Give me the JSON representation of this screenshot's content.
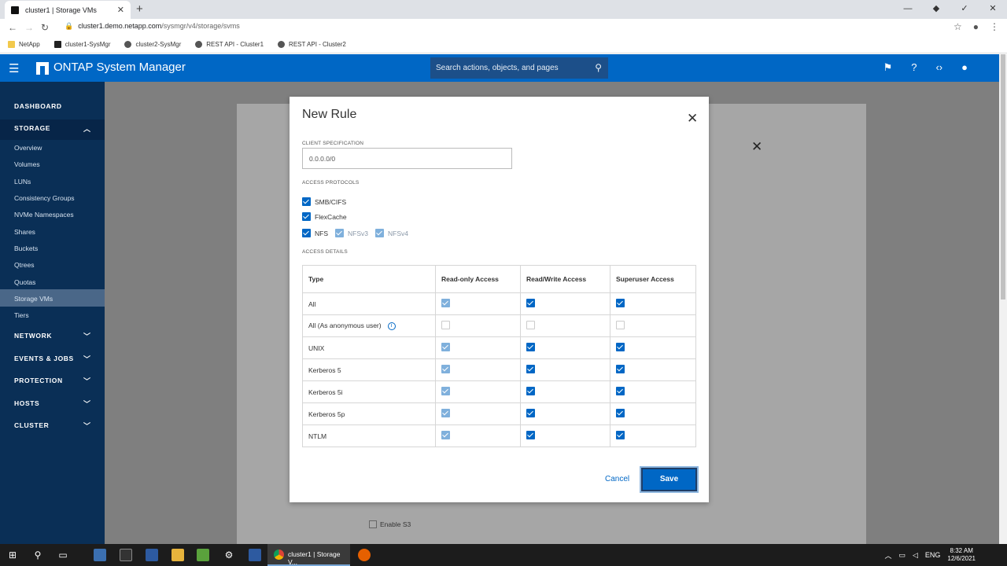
{
  "browser": {
    "tab_title": "cluster1 | Storage VMs",
    "new_tab": "+",
    "url_host": "cluster1.demo.netapp.com",
    "url_path": "/sysmgr/v4/storage/svms",
    "bookmarks": [
      "NetApp",
      "cluster1-SysMgr",
      "cluster2-SysMgr",
      "REST API - Cluster1",
      "REST API - Cluster2"
    ]
  },
  "app": {
    "title": "ONTAP System Manager",
    "search_placeholder": "Search actions, objects, and pages"
  },
  "sidebar": {
    "dashboard": "DASHBOARD",
    "storage": "STORAGE",
    "storage_items": [
      "Overview",
      "Volumes",
      "LUNs",
      "Consistency Groups",
      "NVMe Namespaces",
      "Shares",
      "Buckets",
      "Qtrees",
      "Quotas",
      "Storage VMs",
      "Tiers"
    ],
    "active_item": "Storage VMs",
    "sections": [
      "NETWORK",
      "EVENTS & JOBS",
      "PROTECTION",
      "HOSTS",
      "CLUSTER"
    ]
  },
  "background": {
    "enable_s3": "Enable S3"
  },
  "dialog": {
    "title": "New Rule",
    "client_spec_label": "CLIENT SPECIFICATION",
    "client_spec_value": "0.0.0.0/0",
    "access_protocols_label": "ACCESS PROTOCOLS",
    "protocols": [
      {
        "label": "SMB/CIFS",
        "checked": true
      },
      {
        "label": "FlexCache",
        "checked": true
      },
      {
        "label": "NFS",
        "checked": true
      },
      {
        "label": "NFSv3",
        "checked": true,
        "disabled": true
      },
      {
        "label": "NFSv4",
        "checked": true,
        "disabled": true
      }
    ],
    "access_details_label": "ACCESS DETAILS",
    "table": {
      "headers": [
        "Type",
        "Read-only Access",
        "Read/Write Access",
        "Superuser Access"
      ],
      "rows": [
        {
          "type": "All",
          "ro": "ondis",
          "rw": "on",
          "su": "on"
        },
        {
          "type": "All (As anonymous user)",
          "ro": "off",
          "rw": "off",
          "su": "off",
          "info": true
        },
        {
          "type": "UNIX",
          "ro": "ondis",
          "rw": "on",
          "su": "on"
        },
        {
          "type": "Kerberos 5",
          "ro": "ondis",
          "rw": "on",
          "su": "on"
        },
        {
          "type": "Kerberos 5i",
          "ro": "ondis",
          "rw": "on",
          "su": "on"
        },
        {
          "type": "Kerberos 5p",
          "ro": "ondis",
          "rw": "on",
          "su": "on"
        },
        {
          "type": "NTLM",
          "ro": "ondis",
          "rw": "on",
          "su": "on"
        }
      ]
    },
    "cancel_label": "Cancel",
    "save_label": "Save"
  },
  "taskbar": {
    "active_window": "cluster1 | Storage V...",
    "lang": "ENG",
    "time": "8:32 AM",
    "date": "12/6/2021"
  },
  "colors": {
    "brand_blue": "#0067c5",
    "sidebar_bg": "#0a2f56"
  }
}
